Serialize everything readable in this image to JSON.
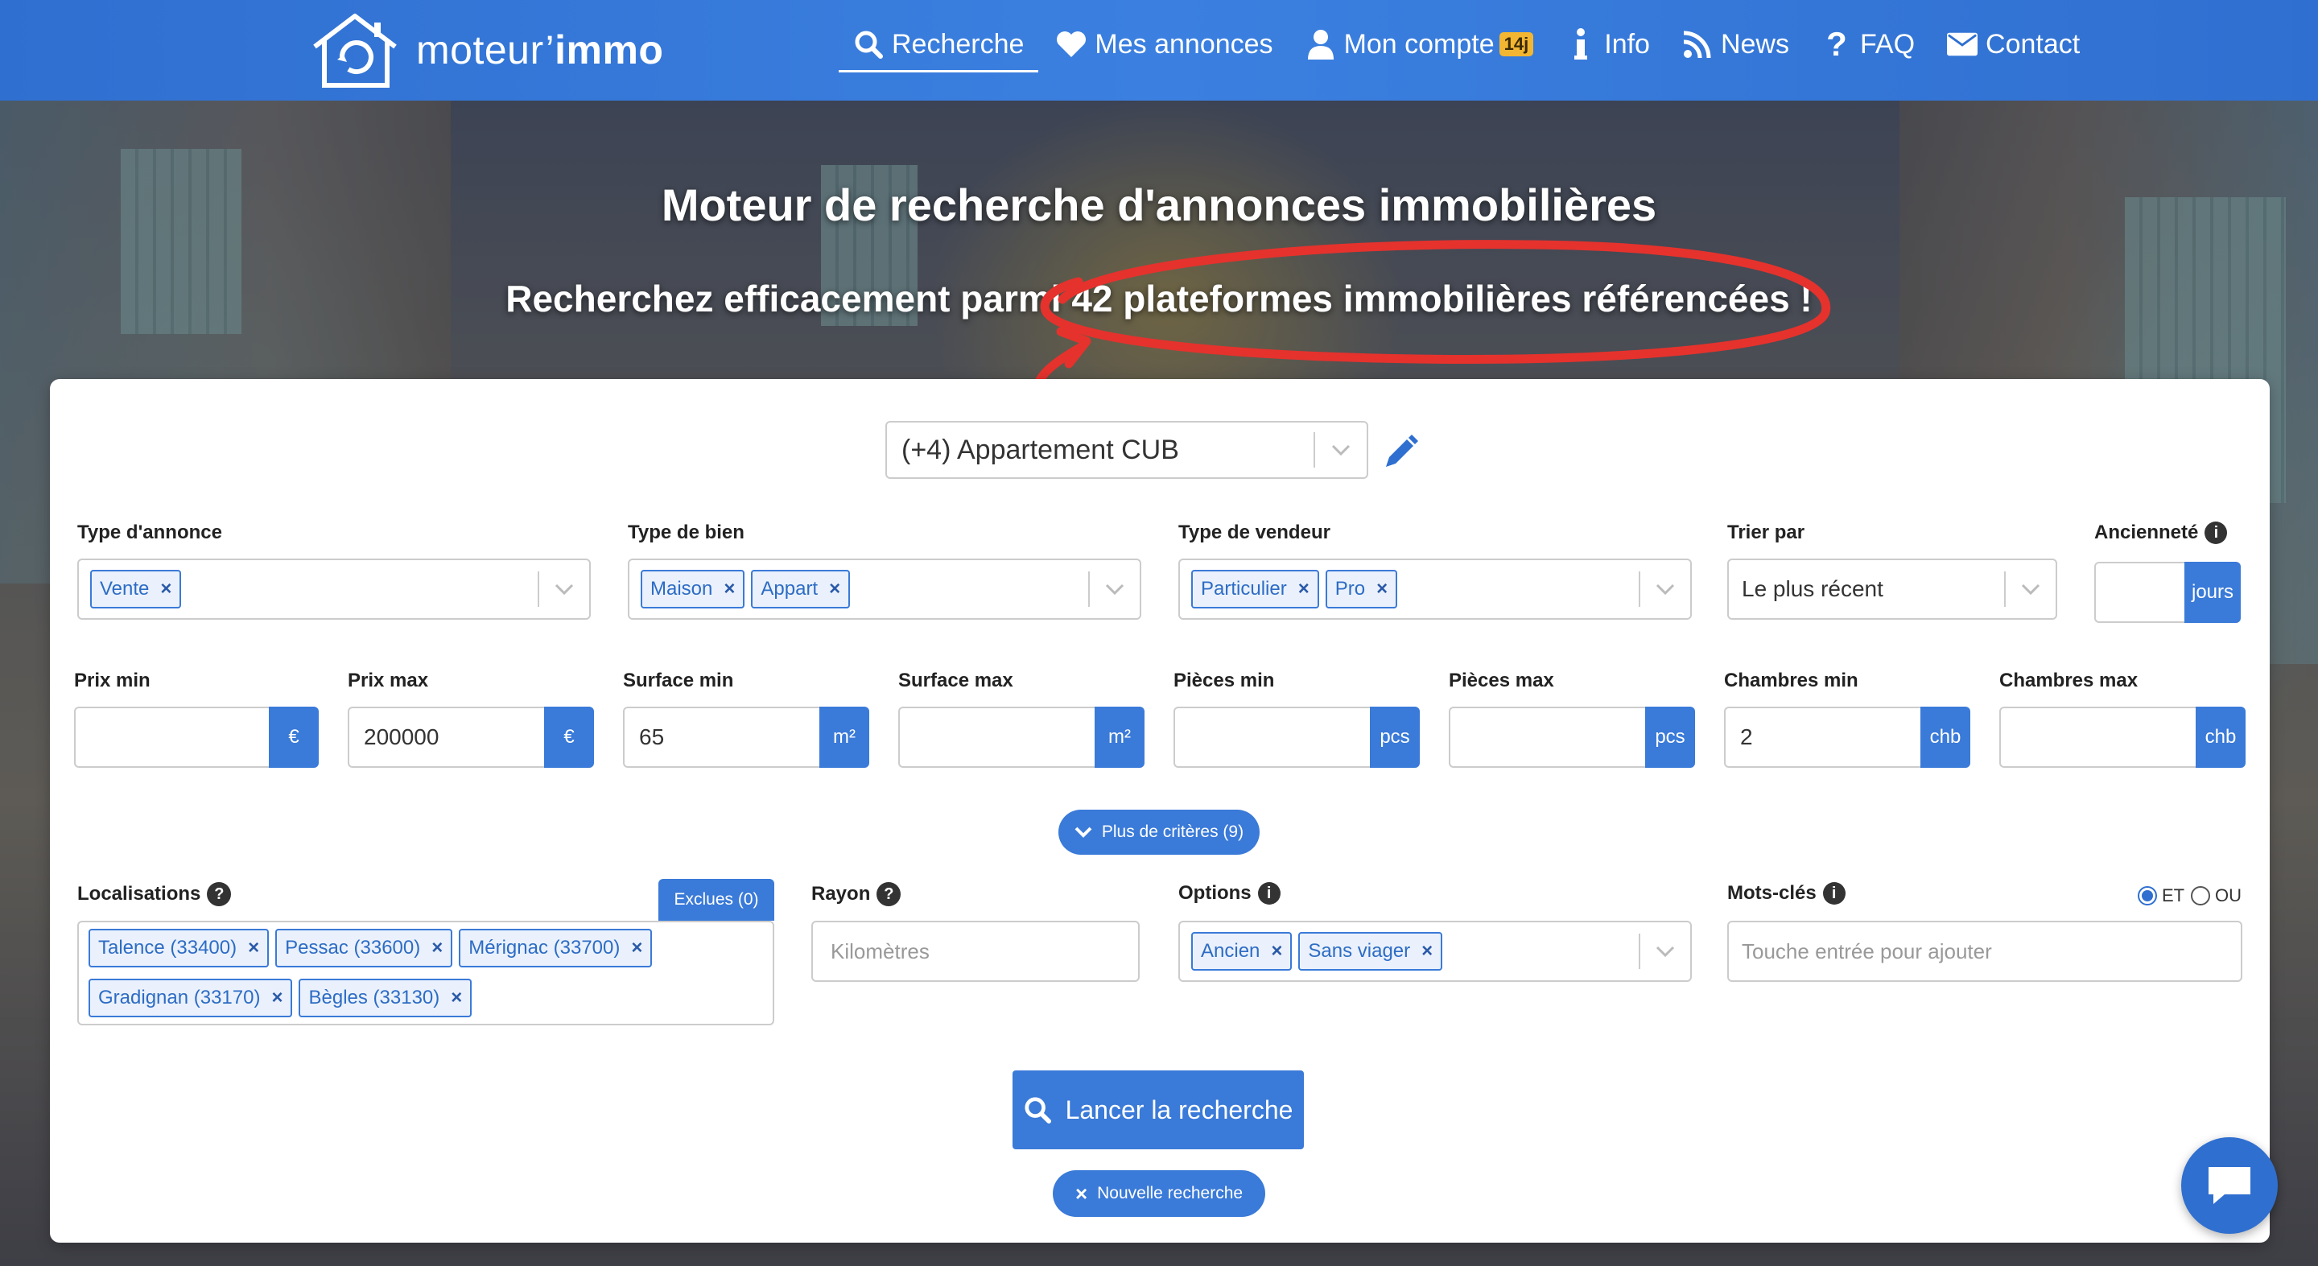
{
  "brand": {
    "name_light": "moteur’",
    "name_bold": "immo"
  },
  "nav": {
    "items": [
      {
        "label": "Recherche",
        "icon": "search-icon",
        "active": true
      },
      {
        "label": "Mes annonces",
        "icon": "heart-icon"
      },
      {
        "label": "Mon compte",
        "icon": "user-icon",
        "badge": "14j"
      },
      {
        "label": "Info",
        "icon": "info-icon"
      },
      {
        "label": "News",
        "icon": "rss-icon"
      },
      {
        "label": "FAQ",
        "icon": "question-icon"
      },
      {
        "label": "Contact",
        "icon": "envelope-icon"
      }
    ]
  },
  "hero": {
    "title": "Moteur de recherche d'annonces immobilières",
    "subtitle": "Recherchez efficacement parmi 42 plateformes immobilières référencées !"
  },
  "saved_search": {
    "value": "(+4) Appartement CUB"
  },
  "filters": {
    "type_annonce": {
      "label": "Type d'annonce",
      "tags": [
        "Vente"
      ]
    },
    "type_bien": {
      "label": "Type de bien",
      "tags": [
        "Maison",
        "Appart"
      ]
    },
    "type_vendeur": {
      "label": "Type de vendeur",
      "tags": [
        "Particulier",
        "Pro"
      ]
    },
    "trier_par": {
      "label": "Trier par",
      "value": "Le plus récent"
    },
    "anciennete": {
      "label": "Ancienneté",
      "addon": "jours",
      "value": ""
    },
    "prix_min": {
      "label": "Prix min",
      "value": "",
      "addon": "€"
    },
    "prix_max": {
      "label": "Prix max",
      "value": "200000",
      "addon": "€"
    },
    "surface_min": {
      "label": "Surface min",
      "value": "65",
      "addon": "m²"
    },
    "surface_max": {
      "label": "Surface max",
      "value": "",
      "addon": "m²"
    },
    "pieces_min": {
      "label": "Pièces min",
      "value": "",
      "addon": "pcs"
    },
    "pieces_max": {
      "label": "Pièces max",
      "value": "",
      "addon": "pcs"
    },
    "chambres_min": {
      "label": "Chambres min",
      "value": "2",
      "addon": "chb"
    },
    "chambres_max": {
      "label": "Chambres max",
      "value": "",
      "addon": "chb"
    },
    "plus_criteres": "Plus de critères (9)",
    "localisations": {
      "label": "Localisations",
      "excluded_button": "Exclues (0)",
      "tags": [
        "Talence (33400)",
        "Pessac (33600)",
        "Mérignac (33700)",
        "Gradignan (33170)",
        "Bègles (33130)"
      ]
    },
    "rayon": {
      "label": "Rayon",
      "placeholder": "Kilomètres"
    },
    "options": {
      "label": "Options",
      "tags": [
        "Ancien",
        "Sans viager"
      ]
    },
    "mots_cles": {
      "label": "Mots-clés",
      "placeholder": "Touche entrée pour ajouter",
      "mode_et": "ET",
      "mode_ou": "OU",
      "selected": "ET"
    }
  },
  "actions": {
    "search": "Lancer la recherche",
    "new_search": "Nouvelle recherche"
  },
  "colors": {
    "primary": "#3a7ad8",
    "navbar": "#2f6fd0",
    "badge": "#f2b632",
    "annotation": "#e5322d"
  }
}
